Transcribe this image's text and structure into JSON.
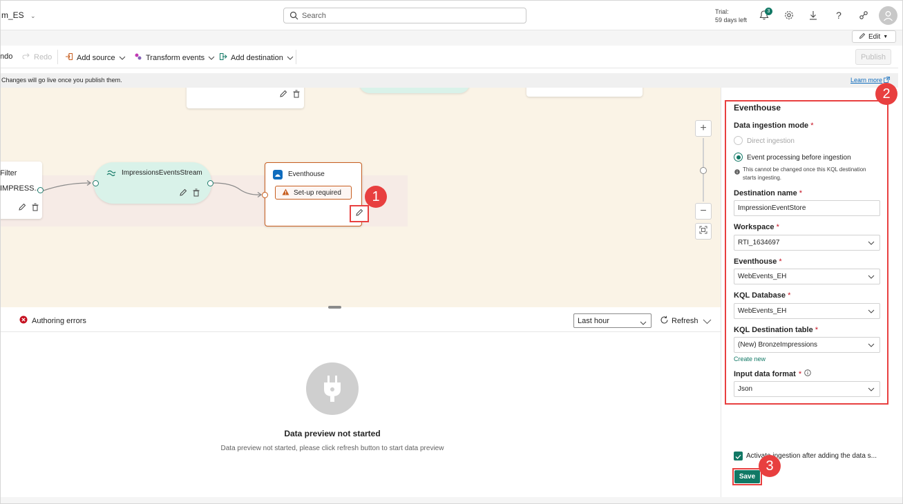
{
  "topbar": {
    "workspace_name": "m_ES",
    "search_placeholder": "Search",
    "trial_line1": "Trial:",
    "trial_line2": "59 days left",
    "notifications_count": "3"
  },
  "editbar": {
    "edit_label": "Edit"
  },
  "toolbar": {
    "undo_label": "ndo",
    "redo_label": "Redo",
    "add_source_label": "Add source",
    "transform_events_label": "Transform events",
    "add_destination_label": "Add destination",
    "publish_label": "Publish"
  },
  "infobar": {
    "message": "Changes will go live once you publish them.",
    "learn_more": "Learn more"
  },
  "canvas": {
    "filter_node": {
      "title": "Filter",
      "subtitle": "IMPRESS..."
    },
    "stream_node": {
      "title": "ImpressionsEventsStream"
    },
    "eventhouse_node": {
      "title": "Eventhouse",
      "warning": "Set-up required"
    }
  },
  "callouts": {
    "one": "1",
    "two": "2",
    "three": "3"
  },
  "bottom_pane": {
    "errors_label": "Authoring errors",
    "time_range": "Last hour",
    "refresh_label": "Refresh",
    "empty_title": "Data preview not started",
    "empty_desc": "Data preview not started, please click refresh button to start data preview"
  },
  "right_panel": {
    "title": "Eventhouse",
    "ingestion_mode_label": "Data ingestion mode",
    "option_direct": "Direct ingestion",
    "option_processing": "Event processing before ingestion",
    "note": "This cannot be changed once this KQL destination starts ingesting.",
    "destination_name_label": "Destination name",
    "destination_name_value": "ImpressionEventStore",
    "workspace_label": "Workspace",
    "workspace_value": "RTI_1634697",
    "eventhouse_label": "Eventhouse",
    "eventhouse_value": "WebEvents_EH",
    "kql_db_label": "KQL Database",
    "kql_db_value": "WebEvents_EH",
    "kql_table_label": "KQL Destination table",
    "kql_table_value": "(New) BronzeImpressions",
    "create_new": "Create new",
    "input_format_label": "Input data format",
    "input_format_value": "Json",
    "activate_label": "Activate ingestion after adding the data s...",
    "save_label": "Save"
  },
  "colors": {
    "accent": "#117865",
    "callout_red": "#e83f3f",
    "canvas_bg": "#faf3e6",
    "stream_node_bg": "#d9f2e9",
    "warning_orange": "#c75d1e"
  }
}
